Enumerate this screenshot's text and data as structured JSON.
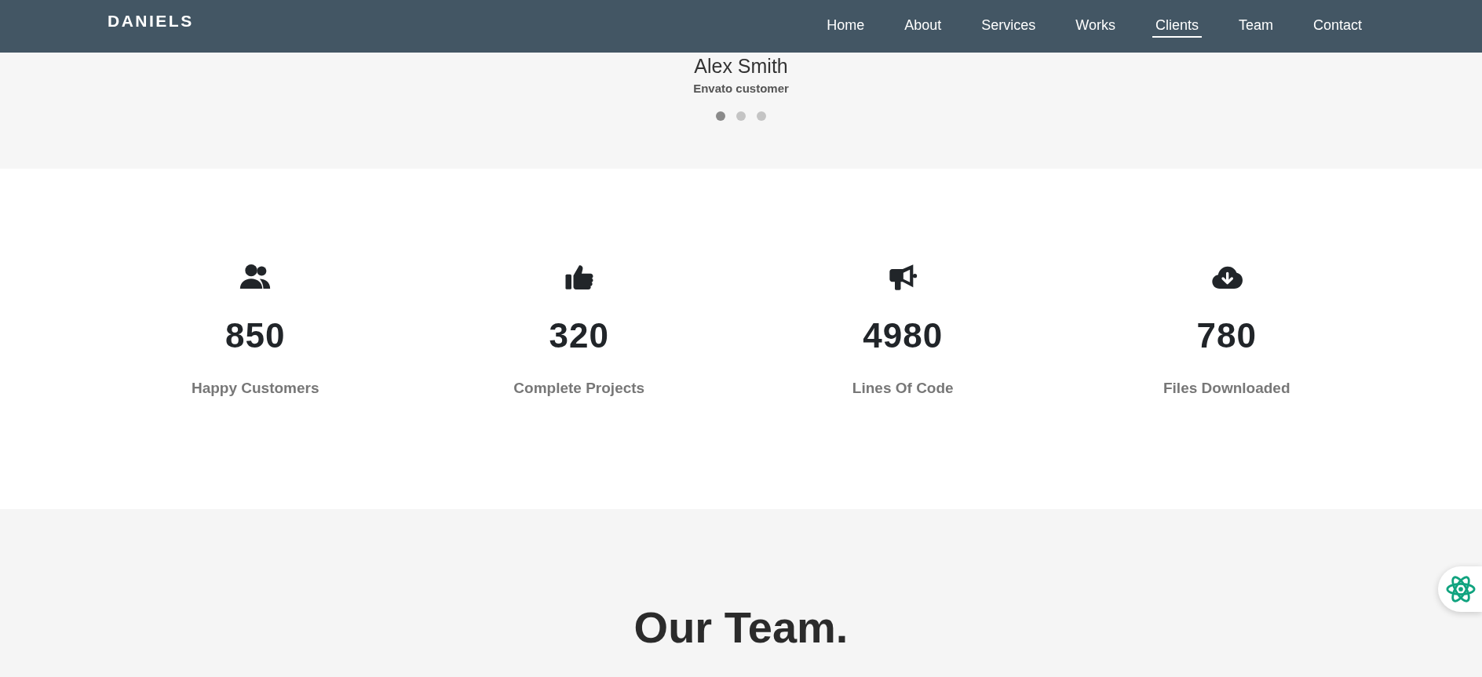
{
  "navbar": {
    "brand": "DANIELS",
    "links": [
      {
        "label": "Home",
        "selected": false
      },
      {
        "label": "About",
        "selected": false
      },
      {
        "label": "Services",
        "selected": false
      },
      {
        "label": "Works",
        "selected": false
      },
      {
        "label": "Clients",
        "selected": true
      },
      {
        "label": "Team",
        "selected": false
      },
      {
        "label": "Contact",
        "selected": false
      }
    ]
  },
  "testimonial": {
    "name": "Alex Smith",
    "role": "Envato customer",
    "dots": [
      {
        "selected": true
      },
      {
        "selected": false
      },
      {
        "selected": false
      }
    ]
  },
  "stats": [
    {
      "number": "850",
      "label": "Happy Customers"
    },
    {
      "number": "320",
      "label": "Complete Projects"
    },
    {
      "number": "4980",
      "label": "Lines Of Code"
    },
    {
      "number": "780",
      "label": "Files Downloaded"
    }
  ],
  "team": {
    "title": "Our Team."
  }
}
